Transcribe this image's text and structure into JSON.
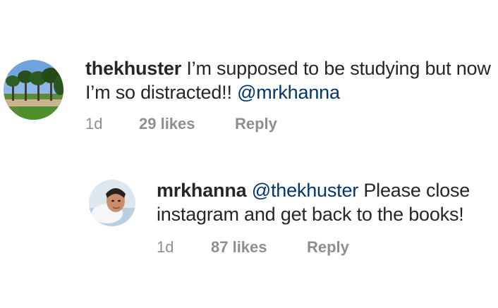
{
  "comments": [
    {
      "username": "thekhuster",
      "text": "I’m supposed to be studying but now I’m so distracted!!",
      "mention": "@mrkhanna",
      "time": "1d",
      "likes": "29 likes",
      "reply": "Reply",
      "avatar_icon": "campus-palm-trees-avatar"
    },
    {
      "username": "mrkhanna",
      "mention": "@thekhuster",
      "text": "Please close instagram and get back to the books!",
      "time": "1d",
      "likes": "87 likes",
      "reply": "Reply",
      "avatar_icon": "person-portrait-avatar"
    }
  ],
  "colors": {
    "text": "#262626",
    "mention": "#00376b",
    "meta": "#8e8e8e"
  }
}
